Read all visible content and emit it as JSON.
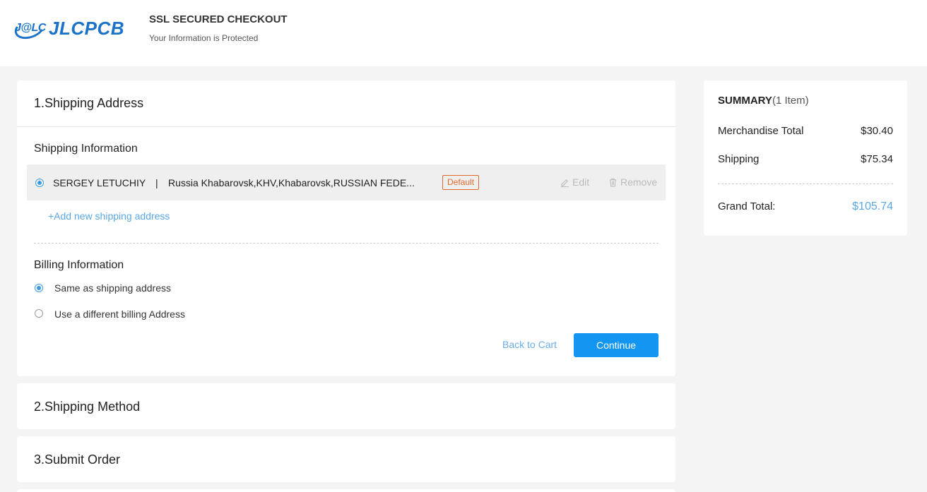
{
  "header": {
    "logo_mark": "J@LC",
    "logo_text": "JLCPCB",
    "title": "SSL SECURED CHECKOUT",
    "subtitle": "Your Information is Protected"
  },
  "shipping": {
    "title": "1.Shipping Address",
    "info_label": "Shipping Information",
    "address": {
      "name": "SERGEY LETUCHIY",
      "separator": "|",
      "text": "Russia Khabarovsk,KHV,Khabarovsk,RUSSIAN FEDE...",
      "badge": "Default",
      "edit_label": "Edit",
      "remove_label": "Remove"
    },
    "add_link": "+Add new shipping address",
    "billing_label": "Billing Information",
    "billing_options": [
      {
        "label": "Same as shipping address",
        "checked": true
      },
      {
        "label": "Use a different billing Address",
        "checked": false
      }
    ],
    "back_label": "Back to Cart",
    "continue_label": "Continue"
  },
  "steps": [
    {
      "title": "2.Shipping Method"
    },
    {
      "title": "3.Submit Order"
    }
  ],
  "summary": {
    "title": "SUMMARY",
    "count": "(1 Item)",
    "rows": [
      {
        "label": "Merchandise Total",
        "value": "$30.40"
      },
      {
        "label": "Shipping",
        "value": "$75.34"
      }
    ],
    "grand_label": "Grand Total:",
    "grand_value": "$105.74"
  },
  "colors": {
    "accent": "#1296f2",
    "link": "#5ba7e5",
    "badge": "#e06a2c",
    "logo": "#1a73c9"
  }
}
